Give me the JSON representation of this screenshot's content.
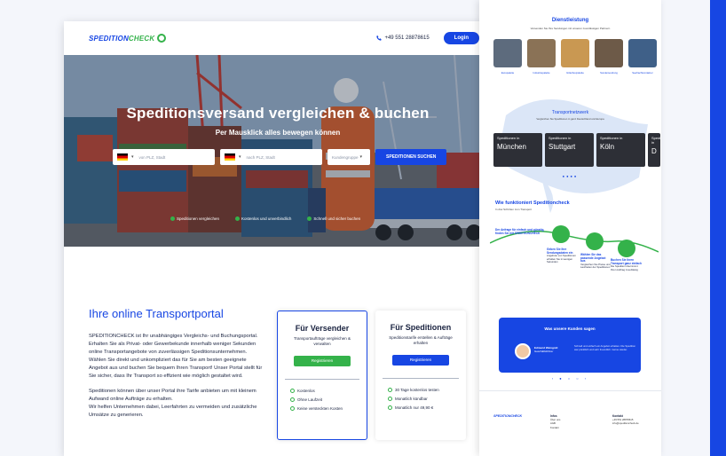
{
  "header": {
    "logo_part1": "SPEDITION",
    "logo_part2": "CHECK",
    "phone": "+49 551 28878615",
    "login_label": "Login"
  },
  "hero": {
    "title": "Speditionsversand vergleichen & buchen",
    "subtitle": "Per Mausklick alles bewegen können",
    "from_placeholder": "von PLZ, Stadt",
    "to_placeholder": "nach PLZ, Stadt",
    "customer_group_placeholder": "Kundengruppe",
    "search_button": "SPEDITIONEN SUCHEN",
    "benefits": [
      "Speditionen vergleichen",
      "Kostenlos und unverbindlich",
      "Schnell und sicher buchen"
    ]
  },
  "about": {
    "title": "Ihre online Transportportal",
    "paragraph1": "SPEDITIONCHECK ist Ihr unabhängiges Vergleichs- und Buchungsportal.",
    "paragraph2": "Erhalten Sie als Privat- oder Gewerbekunde innerhalb weniger Sekunden online Transportangebote von zuverlässigen Speditionsunternehmen.",
    "paragraph3": "Wählen Sie direkt und unkompliziert das für Sie am besten geeignete Angebot aus und buchen Sie bequem Ihren Transport! Unser Portal stellt für Sie sicher, dass Ihr Transport so effizient wie möglich gestaltet wird.",
    "paragraph4": "Speditionen können über unser Portal ihre Tarife anbieten um mit kleinem Aufwand online Aufträge zu erhalten.",
    "paragraph5": "Wir helfen Unternehmen dabei, Leerfahrten zu vermeiden und zusätzliche Umsätze zu generieren."
  },
  "cards": [
    {
      "title": "Für Versender",
      "subtitle": "Transportaufträge vergleichen & verwalten",
      "button": "Registrieren",
      "features": [
        "Kostenlos",
        "Ohne Laufzeit",
        "Keine versteckten Kosten"
      ]
    },
    {
      "title": "Für Speditionen",
      "subtitle": "Speditionstarife erstellen & Aufträge erhalten",
      "button": "Registrieren",
      "features": [
        "30 Tage kostenlos testen",
        "Monatlich kündbar",
        "Monatlich nur 49,90 €"
      ]
    }
  ],
  "right": {
    "services_title": "Dienstleistung",
    "services_sub": "Versenden Sie Ihre Sendungen mit unseren zuverlässigen Partnern",
    "service_labels": [
      "Europalette",
      "Industriepalette",
      "Gitterboxpalette",
      "Sondersendung",
      "Seefrachtcontainer"
    ],
    "network_title": "Transportnetzwerk",
    "network_sub": "Vergleichen Sie Speditionen in ganz Deutschland und Europa",
    "city_prefix": "Speditionen in",
    "cities": [
      "München",
      "Stuttgart",
      "Köln",
      "D"
    ],
    "how_title": "Wie funktioniert Speditioncheck",
    "how_sub": "In drei Schritten zum Transport",
    "step0_title": "Der Anfrage für einfach und günstig, finden Sie mit SPEDITIONCHECK",
    "steps": [
      {
        "title": "Geben Sie Ihre Sendungsdaten ein",
        "text": "Angebote von Speditionen erhalten Sie in wenigen Sekunden"
      },
      {
        "title": "Wählen Sie das passende Angebot aus",
        "text": "Vergleichen Sie Preise und Laufzeiten der Speditionen"
      },
      {
        "title": "Buchen Sie Ihren Transport ganz einfach",
        "text": "Die Spedition übernimmt Ihren Auftrag zuverlässig"
      }
    ],
    "reviews_title": "Was unsere Kunden sagen",
    "review_name": "Edmund Weingold",
    "review_role": "Geschäftsführer",
    "review_text": "Schnell und einfach ein Angebot erhalten. Die Spedition war pünktlich und sehr freundlich. Gerne wieder.",
    "footer_company": "SPEDITIONCHECK",
    "footer_col1_title": "Infos",
    "footer_col1": [
      "Über uns",
      "AGB",
      "Kontakt"
    ],
    "footer_col2_title": "Kontakt",
    "footer_col2": [
      "+49 551 28878615",
      "info@speditioncheck.de"
    ]
  },
  "colors": {
    "brand_blue": "#1746e3",
    "brand_green": "#34b24a"
  }
}
